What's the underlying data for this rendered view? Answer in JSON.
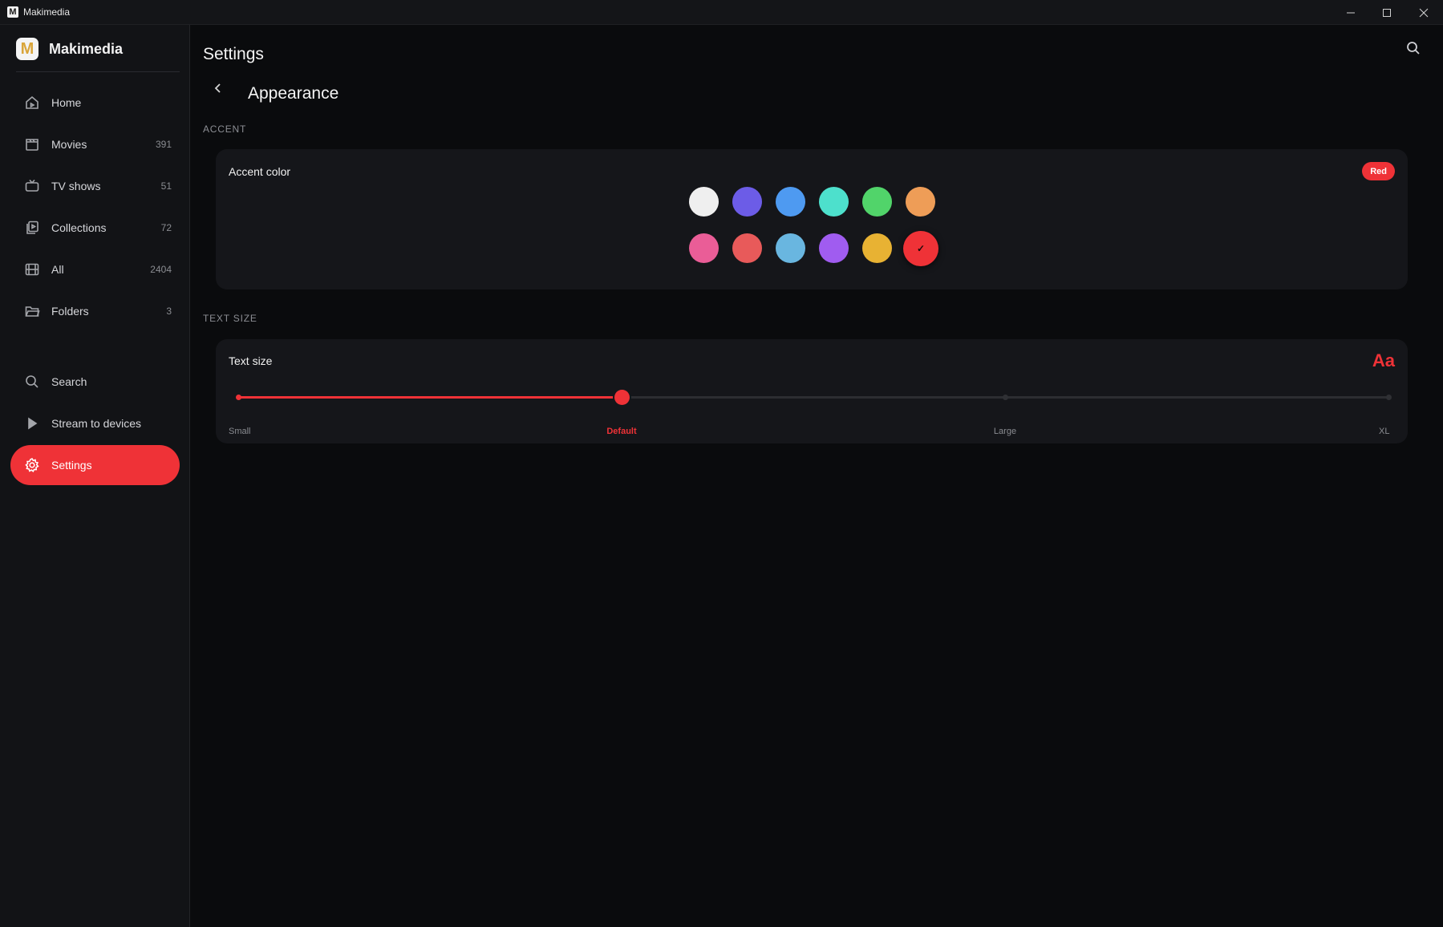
{
  "window": {
    "title": "Makimedia",
    "app_icon_letter": "M"
  },
  "sidebar": {
    "brand": {
      "name": "Makimedia",
      "logo_letter": "M"
    },
    "items": [
      {
        "label": "Home",
        "count": "",
        "icon": "home-icon"
      },
      {
        "label": "Movies",
        "count": "391",
        "icon": "clapperboard-icon"
      },
      {
        "label": "TV shows",
        "count": "51",
        "icon": "tv-icon"
      },
      {
        "label": "Collections",
        "count": "72",
        "icon": "collections-icon"
      },
      {
        "label": "All",
        "count": "2404",
        "icon": "film-icon"
      },
      {
        "label": "Folders",
        "count": "3",
        "icon": "folder-icon"
      },
      {
        "label": "Search",
        "count": "",
        "icon": "search-icon"
      },
      {
        "label": "Stream to devices",
        "count": "",
        "icon": "play-icon"
      },
      {
        "label": "Settings",
        "count": "",
        "icon": "gear-icon",
        "active": true
      }
    ]
  },
  "header": {
    "title": "Settings",
    "subtitle": "Appearance"
  },
  "accent": {
    "section_label": "ACCENT",
    "card_title": "Accent color",
    "selected_label": "Red",
    "swatches": [
      {
        "name": "white",
        "color": "#efefef"
      },
      {
        "name": "indigo",
        "color": "#6c5ce7"
      },
      {
        "name": "blue",
        "color": "#4e9af1"
      },
      {
        "name": "turquoise",
        "color": "#4de0cc"
      },
      {
        "name": "green",
        "color": "#51d46a"
      },
      {
        "name": "orange",
        "color": "#ee9d57"
      },
      {
        "name": "pink",
        "color": "#ea5d97"
      },
      {
        "name": "coral",
        "color": "#e85a5a"
      },
      {
        "name": "sky",
        "color": "#69b6e0"
      },
      {
        "name": "purple",
        "color": "#a05cf0"
      },
      {
        "name": "amber",
        "color": "#e8b233"
      },
      {
        "name": "red",
        "color": "#ef3237",
        "selected": true
      }
    ],
    "check_glyph": "✓"
  },
  "text_size": {
    "section_label": "TEXT SIZE",
    "card_title": "Text size",
    "preview": "Aa",
    "steps": [
      "Small",
      "Default",
      "Large",
      "XL"
    ],
    "selected_index": 1
  },
  "colors": {
    "accent": "#ef3237",
    "background": "#0a0b0d",
    "sidebar": "#121316",
    "card": "#15161a"
  }
}
